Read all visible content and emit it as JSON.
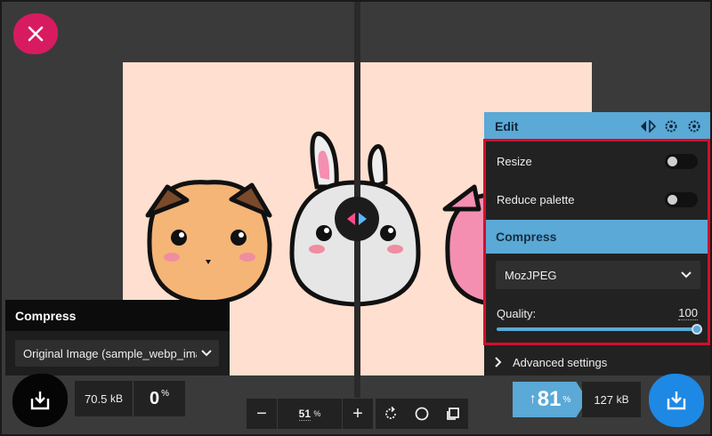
{
  "edit": {
    "title": "Edit",
    "resize_label": "Resize",
    "reduce_palette_label": "Reduce palette",
    "compress_label": "Compress",
    "codec_value": "MozJPEG",
    "quality_label": "Quality:",
    "quality_value": "100",
    "quality_level": 1.0,
    "advanced_label": "Advanced settings",
    "resize_on": false,
    "reduce_palette_on": false
  },
  "left_panel": {
    "title": "Compress",
    "source_value": "Original Image (sample_webp_imag"
  },
  "left_stats": {
    "size": "70.5",
    "size_unit": "kB",
    "percent": "0",
    "percent_unit": "%"
  },
  "zoom": {
    "minus": "−",
    "value": "51",
    "unit": "%",
    "plus": "+"
  },
  "right_stats": {
    "arrow": "↑",
    "percent": "81",
    "percent_unit": "%",
    "size": "127",
    "size_unit": "kB"
  },
  "colors": {
    "accent": "#5aa9d6",
    "close": "#d81b60",
    "download_right": "#1e88e5",
    "highlight": "#d0102a",
    "image_bg": "#ffdfcf"
  },
  "icons": [
    "close-icon",
    "compare-arrows-icon",
    "settings-copy-icon",
    "settings-paste-icon",
    "download-icon",
    "rotate-icon",
    "circle-icon",
    "crop-icon",
    "chevron-down-icon",
    "chevron-right-icon"
  ]
}
